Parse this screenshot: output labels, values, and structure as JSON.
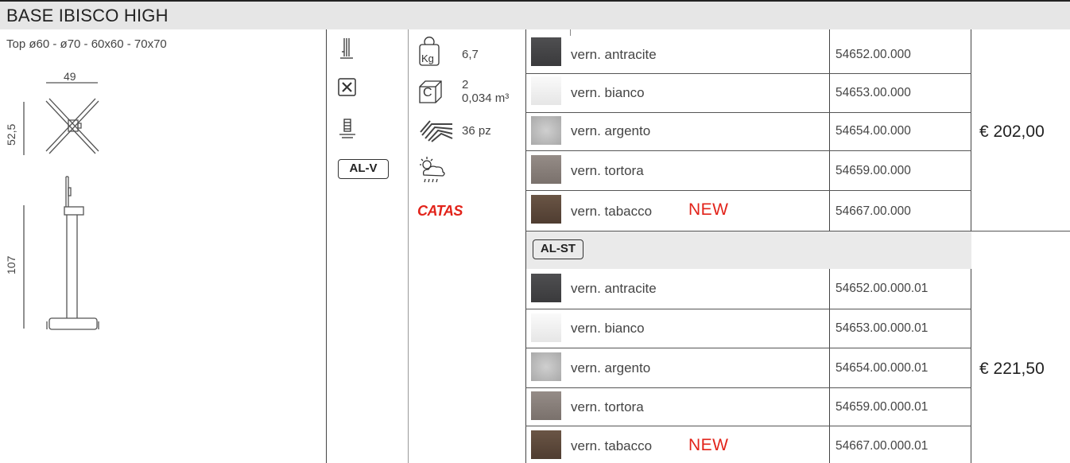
{
  "title": "BASE IBISCO HIGH",
  "subtitle": "Top  ø60 - ø70 - 60x60 - 70x70",
  "dimensions": {
    "width": "49",
    "height_top": "52,5",
    "height_full": "107"
  },
  "specs": {
    "weight": "6,7",
    "weight_unit": "Kg",
    "packaging_count": "2",
    "packaging_volume": "0,034 m³",
    "packaging_letter": "C",
    "pallet": "36 pz",
    "finish_code": "AL-V",
    "certification": "CATAS"
  },
  "group_label": "AL-ST",
  "new_label": "NEW",
  "rows_al_v": [
    {
      "color": "vern. antracite",
      "code": "54652.00.000",
      "swatch": "#4a4a4c",
      "is_new": false
    },
    {
      "color": "vern. bianco",
      "code": "54653.00.000",
      "swatch": "#f2f2f2",
      "is_new": false
    },
    {
      "color": "vern. argento",
      "code": "54654.00.000",
      "swatch": "#b8b8b8",
      "is_new": false
    },
    {
      "color": "vern. tortora",
      "code": "54659.00.000",
      "swatch": "#8a817c",
      "is_new": false
    },
    {
      "color": "vern. tabacco",
      "code": "54667.00.000",
      "swatch": "#5e4a3c",
      "is_new": true
    }
  ],
  "rows_al_st": [
    {
      "color": "vern. antracite",
      "code": "54652.00.000.01",
      "swatch": "#4a4a4c",
      "is_new": false
    },
    {
      "color": "vern. bianco",
      "code": "54653.00.000.01",
      "swatch": "#f2f2f2",
      "is_new": false
    },
    {
      "color": "vern. argento",
      "code": "54654.00.000.01",
      "swatch": "#b8b8b8",
      "is_new": false
    },
    {
      "color": "vern. tortora",
      "code": "54659.00.000.01",
      "swatch": "#8a817c",
      "is_new": false
    },
    {
      "color": "vern. tabacco",
      "code": "54667.00.000.01",
      "swatch": "#5e4a3c",
      "is_new": true
    }
  ],
  "price_al_v": "€ 202,00",
  "price_al_st": "€ 221,50",
  "colors": {
    "new": "#e2231a",
    "catas": "#e2231a",
    "header_bg": "#e6e6e6"
  }
}
